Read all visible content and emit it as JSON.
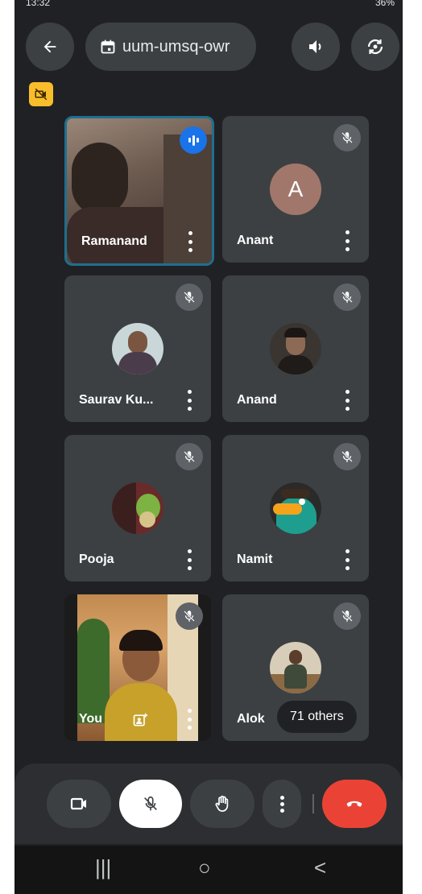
{
  "status_bar": {
    "time": "13:32",
    "battery": "36%"
  },
  "header": {
    "back_icon": "arrow-left-icon",
    "meeting_code": "uum-umsq-owr",
    "calendar_icon": "calendar-icon",
    "speaker_icon": "speaker-icon",
    "switch_camera_icon": "switch-camera-icon"
  },
  "camera_off_badge_icon": "video-off-icon",
  "participants": [
    {
      "name": "Ramanand",
      "speaking": true,
      "muted": false
    },
    {
      "name": "Anant",
      "avatar_letter": "A",
      "muted": true
    },
    {
      "name": "Saurav Ku...",
      "muted": true
    },
    {
      "name": "Anand",
      "muted": true
    },
    {
      "name": "Pooja",
      "muted": true
    },
    {
      "name": "Namit",
      "muted": true
    },
    {
      "name": "You",
      "muted": true
    },
    {
      "name": "Alok",
      "muted": true
    }
  ],
  "others_label": "71 others",
  "controls": {
    "camera_icon": "video-camera-icon",
    "mic_icon": "mic-off-icon",
    "raise_hand_icon": "raise-hand-icon",
    "more_icon": "more-vert-icon",
    "end_call_icon": "end-call-icon"
  },
  "colors": {
    "background": "#202124",
    "tile": "#3c4043",
    "speaking_border": "#8ab4f8",
    "end_call": "#ea4335",
    "badge": "#f9bd2b",
    "avatar_letter_bg": "#a1776b"
  },
  "nav": {
    "recent": "|||",
    "home": "○",
    "back": "<"
  }
}
